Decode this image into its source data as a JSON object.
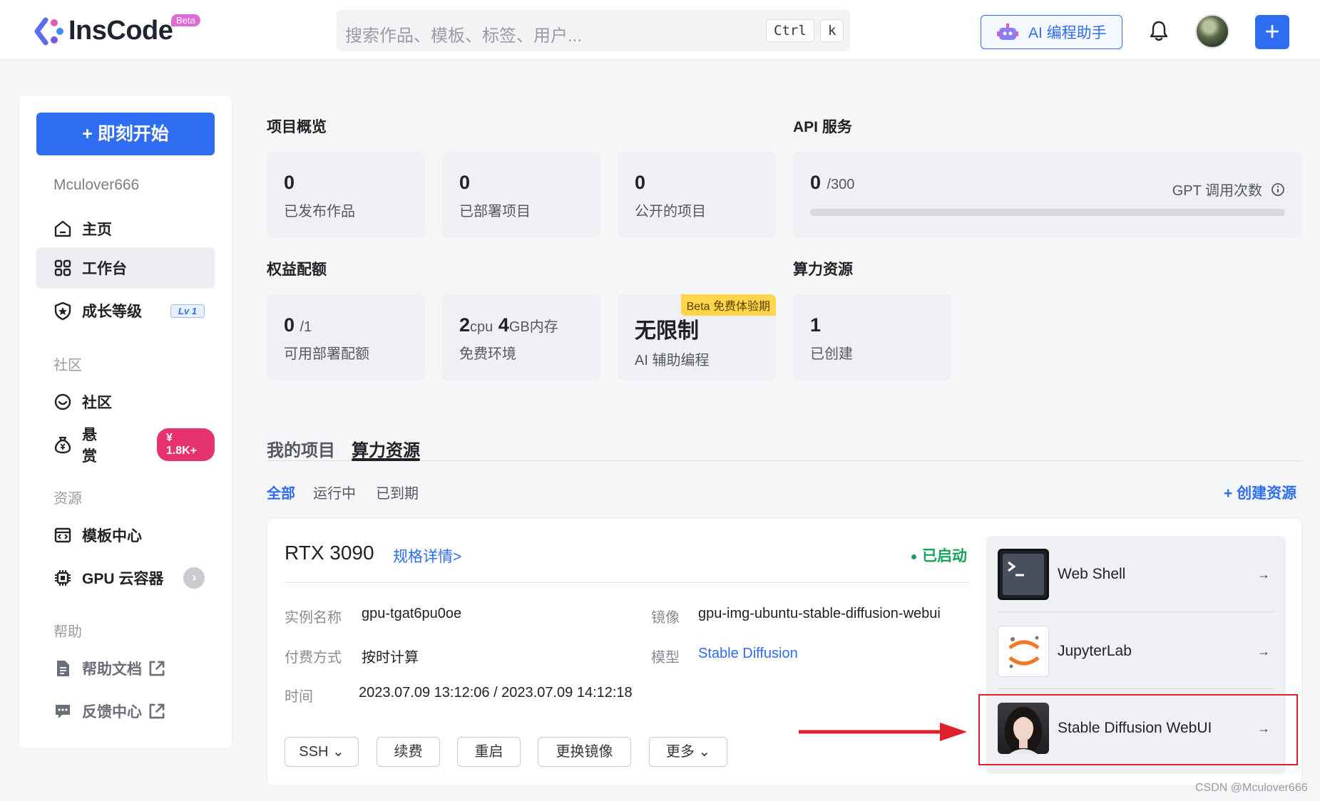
{
  "header": {
    "logo_text": "InsCode",
    "beta": "Beta",
    "search_placeholder": "搜索作品、模板、标签、用户...",
    "kbd_ctrl": "Ctrl",
    "kbd_k": "k",
    "ai_button": "AI 编程助手",
    "plus": "+"
  },
  "sidebar": {
    "start_button": "+ 即刻开始",
    "username": "Mculover666",
    "items": {
      "home": "主页",
      "workbench": "工作台",
      "growth": "成长等级",
      "growth_badge": "Lv 1",
      "community": "社区",
      "bounty": "悬赏",
      "bounty_badge": "¥ 1.8K+",
      "templates": "模板中心",
      "gpu": "GPU 云容器",
      "docs": "帮助文档",
      "feedback": "反馈中心"
    },
    "sections": {
      "community": "社区",
      "resources": "资源",
      "help": "帮助"
    }
  },
  "overview": {
    "title": "项目概览",
    "cards": [
      {
        "num": "0",
        "label": "已发布作品"
      },
      {
        "num": "0",
        "label": "已部署项目"
      },
      {
        "num": "0",
        "label": "公开的项目"
      }
    ]
  },
  "api": {
    "title": "API 服务",
    "used": "0",
    "total": "/300",
    "label": "GPT 调用次数",
    "progress": 0
  },
  "quota": {
    "title": "权益配额",
    "deploy_num": "0",
    "deploy_total": "/1",
    "deploy_label": "可用部署配额",
    "cpu_num": "2",
    "cpu_unit": "cpu",
    "mem_num": "4",
    "mem_unit": "GB内存",
    "env_label": "免费环境",
    "beta_tag": "Beta 免费体验期",
    "unlimited": "无限制",
    "ai_label": "AI 辅助编程"
  },
  "compute": {
    "title": "算力资源",
    "num": "1",
    "label": "已创建"
  },
  "tabs": {
    "my_projects": "我的项目",
    "compute": "算力资源"
  },
  "filters": {
    "all": "全部",
    "running": "运行中",
    "expired": "已到期",
    "create": "+ 创建资源"
  },
  "resource": {
    "name": "RTX 3090",
    "spec_link": "规格详情>",
    "status": "已启动",
    "instance_key": "实例名称",
    "instance_val": "gpu-tgat6pu0oe",
    "image_key": "镜像",
    "image_val": "gpu-img-ubuntu-stable-diffusion-webui",
    "billing_key": "付费方式",
    "billing_val": "按时计算",
    "model_key": "模型",
    "model_val": "Stable Diffusion",
    "time_key": "时间",
    "time_val": "2023.07.09 13:12:06 / 2023.07.09 14:12:18",
    "buttons": {
      "ssh": "SSH",
      "renew": "续费",
      "restart": "重启",
      "change_image": "更换镜像",
      "more": "更多"
    }
  },
  "apps": [
    {
      "label": "Web Shell",
      "arrow": "→"
    },
    {
      "label": "JupyterLab",
      "arrow": "→"
    },
    {
      "label": "Stable Diffusion WebUI",
      "arrow": "→"
    }
  ],
  "watermark": "CSDN @Mculover666",
  "colors": {
    "accent": "#2e6cf2",
    "status_green": "#14a35a",
    "highlight_red": "#e0202a"
  }
}
